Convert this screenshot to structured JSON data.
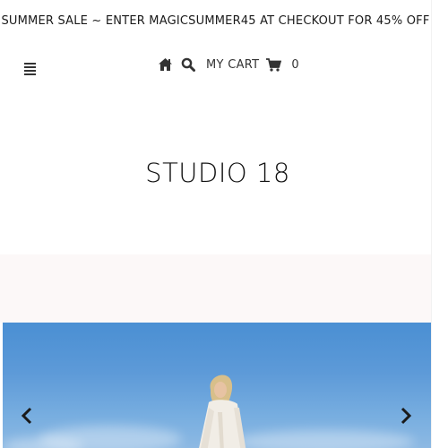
{
  "promo": {
    "text": "SUMMER SALE ~ ENTER MAGICSUMMER45 AT CHECKOUT FOR 45% OFF"
  },
  "header": {
    "menu_icon": "hamburger-menu-icon",
    "home_icon": "home-icon",
    "search_icon": "search-icon",
    "cart_label": "MY CART",
    "cart_icon": "cart-icon",
    "cart_count": "0"
  },
  "brand": {
    "logo_text": "STUDIO 18"
  },
  "slideshow": {
    "prev_icon": "chevron-left-icon",
    "next_icon": "chevron-right-icon"
  },
  "colors": {
    "sky": "#4a8fd3",
    "band": "#fcf8f8",
    "text": "#1a1a1a"
  }
}
